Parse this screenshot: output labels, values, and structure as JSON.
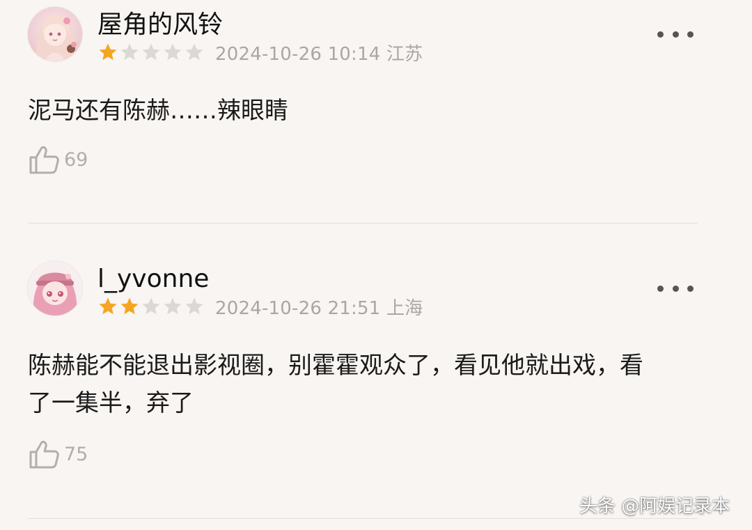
{
  "colors": {
    "background": "#f8f5f2",
    "star_filled": "#f4a623",
    "star_empty": "#dcd9d5",
    "meta_text": "#aaa7a3"
  },
  "reviews": [
    {
      "username": "屋角的风铃",
      "rating": 1,
      "max_rating": 5,
      "datetime": "2024-10-26 10:14",
      "location": "江苏",
      "content": "泥马还有陈赫……辣眼睛",
      "likes": "69",
      "like_icon": "thumbs-up-icon",
      "more_icon": "more-dots-icon"
    },
    {
      "username": "l_yvonne",
      "rating": 2,
      "max_rating": 5,
      "datetime": "2024-10-26 21:51",
      "location": "上海",
      "content": "陈赫能不能退出影视圈，别霍霍观众了，看见他就出戏，看了一集半，弃了",
      "likes": "75",
      "like_icon": "thumbs-up-icon",
      "more_icon": "more-dots-icon"
    }
  ],
  "watermark": "头条 @阿娱记录本"
}
